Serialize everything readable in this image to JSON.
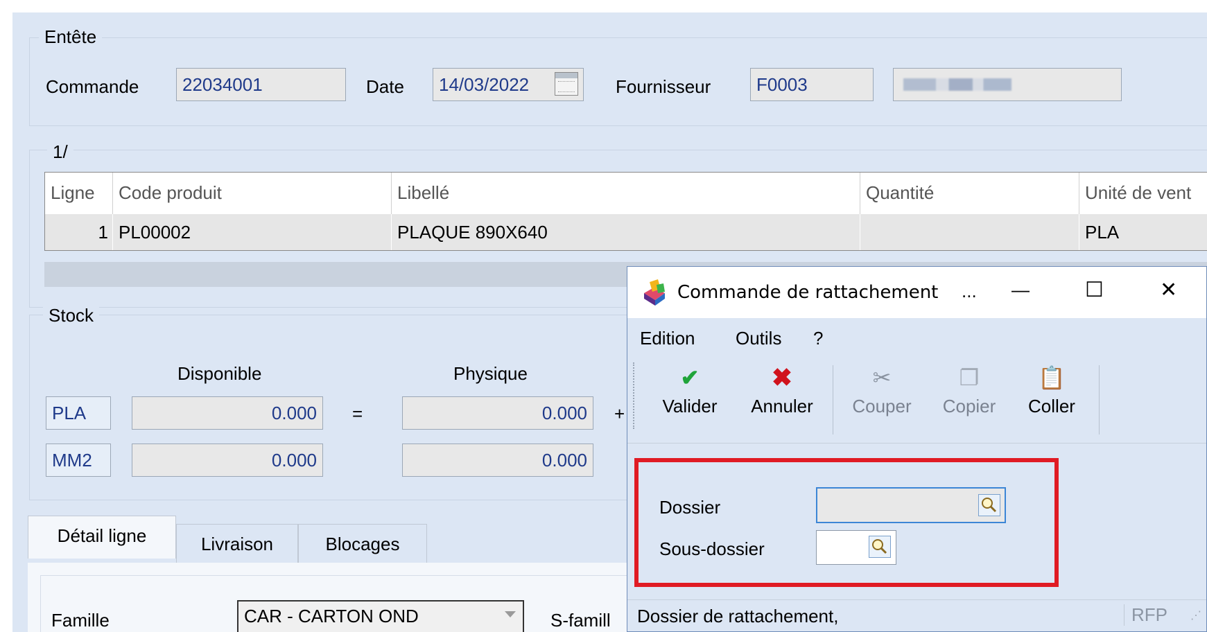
{
  "entete": {
    "legend": "Entête",
    "commande_label": "Commande",
    "commande_value": "22034001",
    "date_label": "Date",
    "date_value": "14/03/2022",
    "fournisseur_label": "Fournisseur",
    "fournisseur_code": "F0003",
    "fournisseur_name": ""
  },
  "lines": {
    "legend": "1/",
    "columns": [
      "Ligne",
      "Code produit",
      "Libellé",
      "Quantité",
      "Unité de vent"
    ],
    "rows": [
      {
        "ligne": "1",
        "code": "PL00002",
        "libelle": "PLAQUE 890X640",
        "quantite": "",
        "unite": "PLA"
      }
    ]
  },
  "stock": {
    "legend": "Stock",
    "disponible_label": "Disponible",
    "physique_label": "Physique",
    "rows": [
      {
        "unit": "PLA",
        "disponible": "0.000",
        "op": "=",
        "physique": "0.000",
        "op2": "+"
      },
      {
        "unit": "MM2",
        "disponible": "0.000",
        "physique": "0.000"
      }
    ]
  },
  "tabs": [
    {
      "label": "Détail ligne",
      "active": true
    },
    {
      "label": "Livraison",
      "active": false
    },
    {
      "label": "Blocages",
      "active": false
    }
  ],
  "detail": {
    "famille_label": "Famille",
    "famille_value": "CAR - CARTON OND",
    "sfamille_label": "S-famill"
  },
  "popup": {
    "title": "Commande de rattachement",
    "title_ellipsis": "...",
    "minimize": "—",
    "maximize": "☐",
    "close": "✕",
    "menu": [
      "Edition",
      "Outils",
      "?"
    ],
    "toolbar": {
      "valider": "Valider",
      "annuler": "Annuler",
      "couper": "Couper",
      "copier": "Copier",
      "coller": "Coller"
    },
    "dossier_label": "Dossier",
    "dossier_value": "",
    "sousdossier_label": "Sous-dossier",
    "sousdossier_value": "",
    "status_text": "Dossier de rattachement,",
    "status_code": "RFP",
    "accent_color": "#e01b24"
  }
}
